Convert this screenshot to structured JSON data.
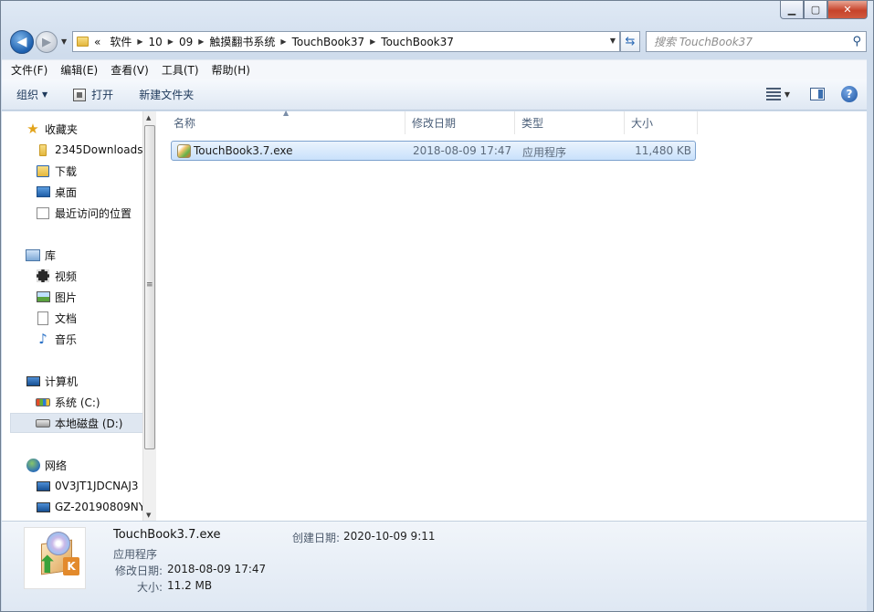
{
  "window": {
    "minimize": "▁",
    "maximize": "▢",
    "close": "✕"
  },
  "nav": {
    "back": "◀",
    "forward": "▶",
    "overflow": "«",
    "breadcrumbs": [
      "软件",
      "10",
      "09",
      "触摸翻书系统",
      "TouchBook37",
      "TouchBook37"
    ],
    "search_placeholder": "搜索 TouchBook37"
  },
  "menu": [
    "文件(F)",
    "编辑(E)",
    "查看(V)",
    "工具(T)",
    "帮助(H)"
  ],
  "toolbar": {
    "organize": "组织",
    "open": "打开",
    "new_folder": "新建文件夹",
    "help": "?"
  },
  "sidebar": {
    "favorites_header": "收藏夹",
    "favorites": [
      "2345Downloads",
      "下载",
      "桌面",
      "最近访问的位置"
    ],
    "libraries_header": "库",
    "libraries": [
      "视频",
      "图片",
      "文档",
      "音乐"
    ],
    "computer_header": "计算机",
    "drives": [
      "系统 (C:)",
      "本地磁盘 (D:)"
    ],
    "network_header": "网络",
    "network": [
      "0V3JT1JDCNAJ3",
      "GZ-20190809NY"
    ]
  },
  "columns": [
    "名称",
    "修改日期",
    "类型",
    "大小"
  ],
  "files": [
    {
      "name": "TouchBook3.7.exe",
      "modified": "2018-08-09 17:47",
      "type": "应用程序",
      "size": "11,480 KB"
    }
  ],
  "details": {
    "name": "TouchBook3.7.exe",
    "type": "应用程序",
    "modified_label": "修改日期:",
    "modified": "2018-08-09 17:47",
    "size_label": "大小:",
    "size": "11.2 MB",
    "created_label": "创建日期:",
    "created": "2020-10-09 9:11"
  }
}
